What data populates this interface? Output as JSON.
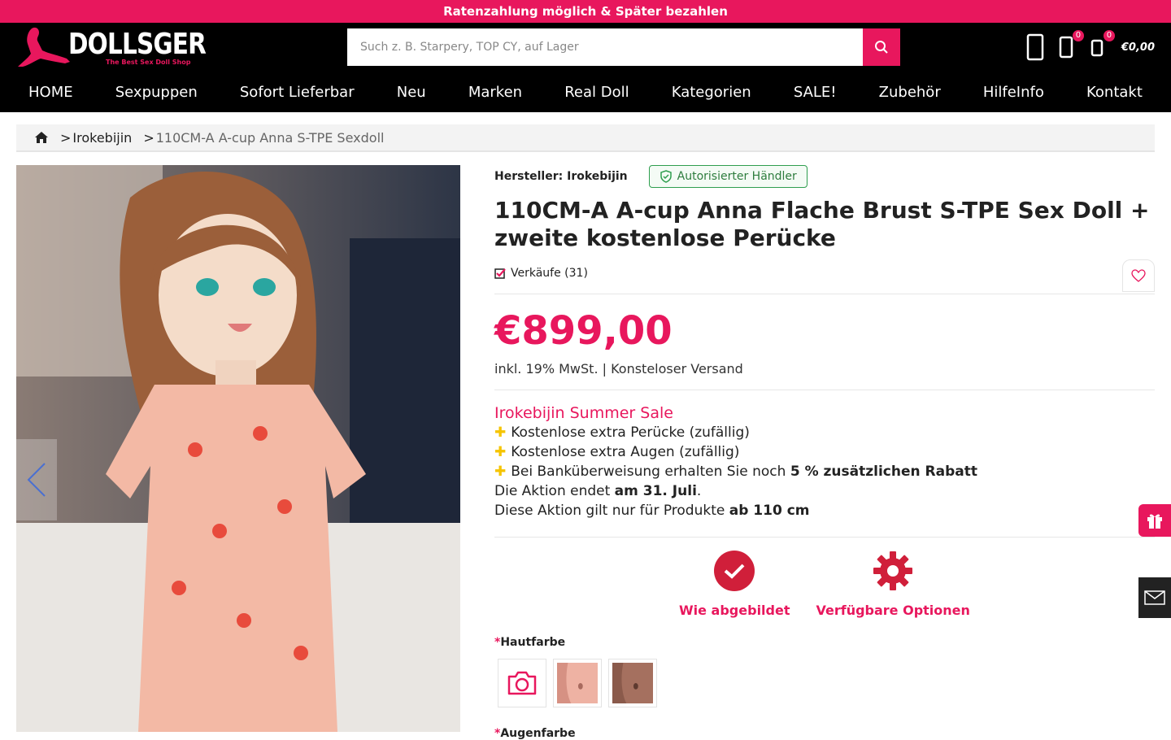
{
  "topbar": {
    "text": "Ratenzahlung möglich & Später bezahlen"
  },
  "header": {
    "brand": "DOLLSGER",
    "tagline": "The Best Sex Doll Shop",
    "search_placeholder": "Such z. B. Starpery, TOP CY, auf Lager",
    "compare_count": "0",
    "cart_count": "0",
    "cart_total": "€0,00"
  },
  "nav": {
    "items": [
      "HOME",
      "Sexpuppen ",
      "Sofort Lieferbar",
      "Neu",
      "Marken ",
      "Real Doll",
      "Kategorien ",
      "SALE!",
      "Zubehör ",
      "HilfeInfo ",
      "Kontakt"
    ]
  },
  "breadcrumb": {
    "sep": ">",
    "items": [
      "Irokebijin",
      "110CM-A A-cup Anna S-TPE Sexdoll"
    ]
  },
  "product": {
    "maker": "Hersteller: Irokebijin",
    "authorized": "Autorisierter Händler",
    "title": "110CM-A A-cup Anna Flache Brust S-TPE Sex Doll + zweite kostenlose Perücke",
    "sales": "Verkäufe (31)",
    "price": "€899,00",
    "vat": "inkl. 19% MwSt. | Konsteloser Versand"
  },
  "promo": {
    "head": " Irokebijin Summer Sale ",
    "line1": "Kostenlose extra Perücke (zufällig)",
    "line2": "Kostenlose extra Augen (zufällig)",
    "line3a": "Bei Banküberweisung erhalten Sie noch ",
    "line3b": "5 % zusätzlichen Rabatt",
    "line4a": " Die Aktion endet ",
    "line4b": "am 31. Juli",
    "line4c": ".",
    "line5a": "Diese Aktion gilt nur für Produkte ",
    "line5b": "ab 110 cm"
  },
  "options": {
    "as_pictured": "Wie abgebildet",
    "available": "Verfügbare Optionen"
  },
  "fields": {
    "required_mark": "*",
    "skin": "Hautfarbe",
    "eyes": "Augenfarbe"
  },
  "colors": {
    "accent": "#e8175d",
    "option_red": "#d01f3a",
    "authorized_green": "#2e9e4e",
    "promo_plus": "#f5c400"
  }
}
